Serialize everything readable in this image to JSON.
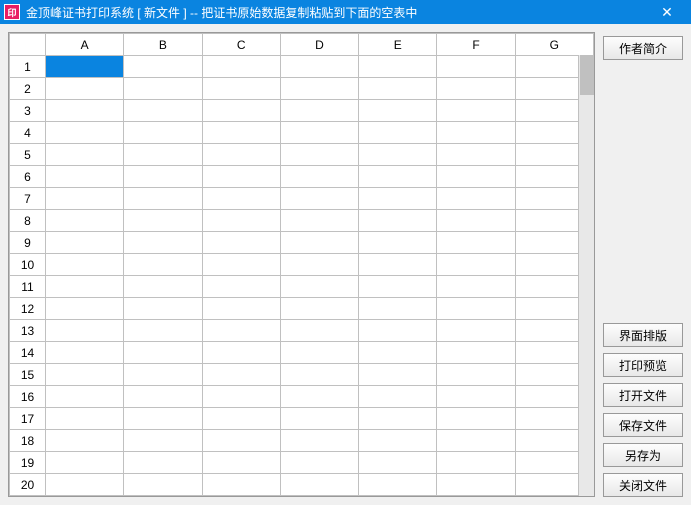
{
  "window": {
    "title": "金顶峰证书打印系统 [ 新文件 ] -- 把证书原始数据复制粘贴到下面的空表中",
    "close_label": "✕"
  },
  "grid": {
    "columns": [
      "A",
      "B",
      "C",
      "D",
      "E",
      "F",
      "G"
    ],
    "row_count": 20,
    "selected": {
      "row": 1,
      "col": "A"
    }
  },
  "buttons": {
    "author_info": "作者简介",
    "layout": "界面排版",
    "print_preview": "打印预览",
    "open_file": "打开文件",
    "save_file": "保存文件",
    "save_as": "另存为",
    "close_file": "关闭文件"
  }
}
